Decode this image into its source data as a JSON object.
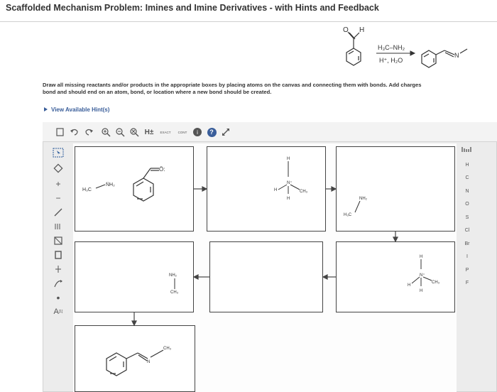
{
  "header": {
    "title": "Scaffolded Mechanism Problem: Imines and Imine Derivatives - with Hints and Feedback"
  },
  "reaction": {
    "reagent_top": "H₃C–NH₂",
    "reagent_bottom": "H⁺, H₂O",
    "aldehyde_o": "O",
    "aldehyde_h": "H",
    "product_n": "N"
  },
  "instructions": {
    "line1": "Draw all missing reactants and/or products in the appropriate boxes by placing atoms on the canvas and connecting them with bonds. Add charges",
    "line2": "bond and should end on an atom, bond, or location where a new bond should be created."
  },
  "hints": {
    "label": "View Available Hint(s)"
  },
  "toolbar": {
    "h_label": "H±",
    "exact_label": "EXACT",
    "cont_label": "CONT",
    "info_symbol": "i",
    "help_symbol": "?"
  },
  "left_tools": {
    "atom_label": "A",
    "atom_sup": "[1]"
  },
  "atoms": [
    "H",
    "C",
    "N",
    "O",
    "S",
    "Cl",
    "Br",
    "I",
    "P",
    "F"
  ],
  "canvas": {
    "box1": {
      "methylamine_c": "H₃C",
      "methylamine_n": "N̈H₂",
      "aldehyde_o": "Ö:"
    },
    "box2": {
      "h_top": "H",
      "h_left": "H",
      "h_bottom": "H",
      "n_plus": "N⁺",
      "ch3": "CH₃"
    },
    "box3": {
      "nh2": "NH₂",
      "h3c": "H₃C"
    },
    "box4": {
      "nh2": "NH₂",
      "ch3": "CH₃"
    },
    "box6": {
      "h_top": "H",
      "h_left": "H",
      "h_bottom": "H",
      "n_plus": "N⁺",
      "ch3": "CH₃"
    },
    "box7": {
      "n": "N",
      "ch3": "CH₃"
    }
  },
  "colors": {
    "accent": "#3a5e9a",
    "help": "#3a5e9a",
    "draw_icon": "#2a5a9a"
  }
}
